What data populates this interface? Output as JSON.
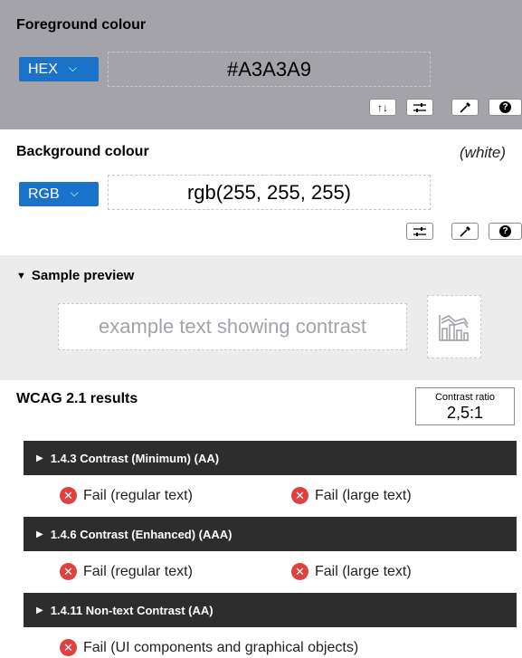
{
  "foreground": {
    "title": "Foreground colour",
    "format": "HEX",
    "value": "#A3A3A9",
    "tools": {
      "swap_icon": "swap-icon",
      "adjust_icon": "sliders-icon",
      "picker_icon": "eyedropper-icon",
      "help_icon": "help-icon"
    }
  },
  "background": {
    "title": "Background colour",
    "name": "(white)",
    "format": "RGB",
    "value": "rgb(255, 255, 255)"
  },
  "preview": {
    "title": "Sample preview",
    "sample_text": "example text showing contrast"
  },
  "results": {
    "title": "WCAG 2.1 results",
    "ratio_label": "Contrast ratio",
    "ratio_value": "2,5:1",
    "criteria": [
      {
        "title": "1.4.3 Contrast (Minimum) (AA)",
        "results": [
          "Fail (regular text)",
          "Fail (large text)"
        ]
      },
      {
        "title": "1.4.6 Contrast (Enhanced) (AAA)",
        "results": [
          "Fail (regular text)",
          "Fail (large text)"
        ]
      },
      {
        "title": "1.4.11 Non-text Contrast (AA)",
        "results": [
          "Fail (UI components and graphical objects)"
        ]
      }
    ]
  },
  "colors": {
    "foreground": "#A3A3A9",
    "background": "#FFFFFF",
    "select_blue": "#1A73C8",
    "fail_red": "#E0403F",
    "criteria_bar": "#2D2D2D"
  }
}
